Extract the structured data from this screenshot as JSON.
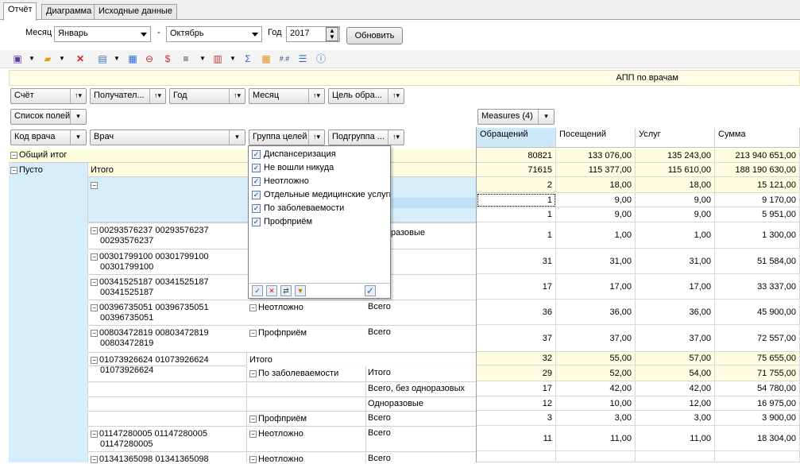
{
  "tabs": [
    "Отчёт",
    "Диаграмма",
    "Исходные данные"
  ],
  "params": {
    "month_label": "Месяц",
    "month_from": "Январь",
    "dash": "-",
    "month_to": "Октябрь",
    "year_label": "Год",
    "year_value": "2017",
    "refresh_label": "Обновить"
  },
  "report_title": "АПП по врачам",
  "filter_fields": [
    "Счёт",
    "Получател...",
    "Год",
    "Месяц",
    "Цель обра..."
  ],
  "field_list_label": "Список полей",
  "measures_label": "Measures (4)",
  "row_fields": [
    "Код врача",
    "Врач",
    "Группа целей",
    "Подгруппа ..."
  ],
  "measure_headers": [
    "Обращений",
    "Посещений",
    "Услуг",
    "Сумма"
  ],
  "popup_items": [
    "Диспансеризация",
    "Не вошли никуда",
    "Неотложно",
    "Отдельные медицинские услуги",
    "По заболеваемости",
    "Профприём"
  ],
  "icons": [
    "save-icon",
    "open-icon",
    "delete-icon",
    "export-icon",
    "print-icon",
    "filter-icon",
    "chart-icon",
    "sort-icon",
    "options-icon",
    "sum-icon",
    "table-icon",
    "format-icon",
    "list-icon",
    "info-icon"
  ],
  "grid": {
    "grand_total": "Общий итог",
    "empty": "Пусто",
    "total": "Итого",
    "one_time_partial": "разовые",
    "rows": [
      {
        "code": "",
        "doctor": "",
        "group": "",
        "sub": "",
        "values": [
          "80821",
          "133 076,00",
          "135 243,00",
          "213 940 651,00"
        ],
        "hl": true
      },
      {
        "code": "",
        "doctor": "",
        "group": "",
        "sub": "",
        "values": [
          "71615",
          "115 377,00",
          "115 610,00",
          "188 190 630,00"
        ],
        "hl": true
      },
      {
        "code": "",
        "doctor": "",
        "group": "",
        "sub": "",
        "values": [
          "2",
          "18,00",
          "18,00",
          "15 121,00"
        ],
        "hl": true
      },
      {
        "code": "",
        "doctor": "",
        "group": "",
        "sub": "",
        "values": [
          "1",
          "9,00",
          "9,00",
          "9 170,00"
        ],
        "hl": false
      },
      {
        "code": "",
        "doctor": "",
        "group": "",
        "sub": "",
        "values": [
          "1",
          "9,00",
          "9,00",
          "5 951,00"
        ],
        "hl": false
      },
      {
        "code": "00293576237 00293576237",
        "code2": "00293576237",
        "doctor": "",
        "group": "",
        "sub": "",
        "values": [
          "1",
          "1,00",
          "1,00",
          "1 300,00"
        ],
        "hl": false
      },
      {
        "code": "00301799100 00301799100",
        "code2": "00301799100",
        "values": [
          "31",
          "31,00",
          "31,00",
          "51 584,00"
        ],
        "hl": false
      },
      {
        "code": "00341525187 00341525187",
        "code2": "00341525187",
        "values": [
          "17",
          "17,00",
          "17,00",
          "33 337,00"
        ],
        "hl": false
      },
      {
        "code": "00396735051 00396735051",
        "code2": "00396735051",
        "group": "Неотложно",
        "sub": "Всего",
        "values": [
          "36",
          "36,00",
          "36,00",
          "45 900,00"
        ],
        "hl": false
      },
      {
        "code": "00803472819 00803472819",
        "code2": "00803472819",
        "group": "Профприём",
        "sub": "Всего",
        "values": [
          "37",
          "37,00",
          "37,00",
          "72 557,00"
        ],
        "hl": false
      },
      {
        "code": "01073926624 01073926624",
        "code2": "01073926624",
        "group": "Итого",
        "sub": "",
        "values": [
          "32",
          "55,00",
          "57,00",
          "75 655,00"
        ],
        "hl": true
      },
      {
        "group": "По заболеваемости",
        "sub": "Итого",
        "values": [
          "29",
          "52,00",
          "54,00",
          "71 755,00"
        ],
        "hl": true
      },
      {
        "sub": "Всего, без одноразовых",
        "values": [
          "17",
          "42,00",
          "42,00",
          "54 780,00"
        ],
        "hl": false
      },
      {
        "sub": "Одноразовые",
        "values": [
          "12",
          "10,00",
          "12,00",
          "16 975,00"
        ],
        "hl": false
      },
      {
        "group": "Профприём",
        "sub": "Всего",
        "values": [
          "3",
          "3,00",
          "3,00",
          "3 900,00"
        ],
        "hl": false
      },
      {
        "code": "01147280005 01147280005",
        "code2": "01147280005",
        "group": "Неотложно",
        "sub": "Всего",
        "values": [
          "11",
          "11,00",
          "11,00",
          "18 304,00"
        ],
        "hl": false
      },
      {
        "code": "01341365098 01341365098",
        "group": "Неотложно",
        "sub": "Всего",
        "values": [
          "",
          "",
          "",
          ""
        ],
        "hl": false
      }
    ]
  }
}
